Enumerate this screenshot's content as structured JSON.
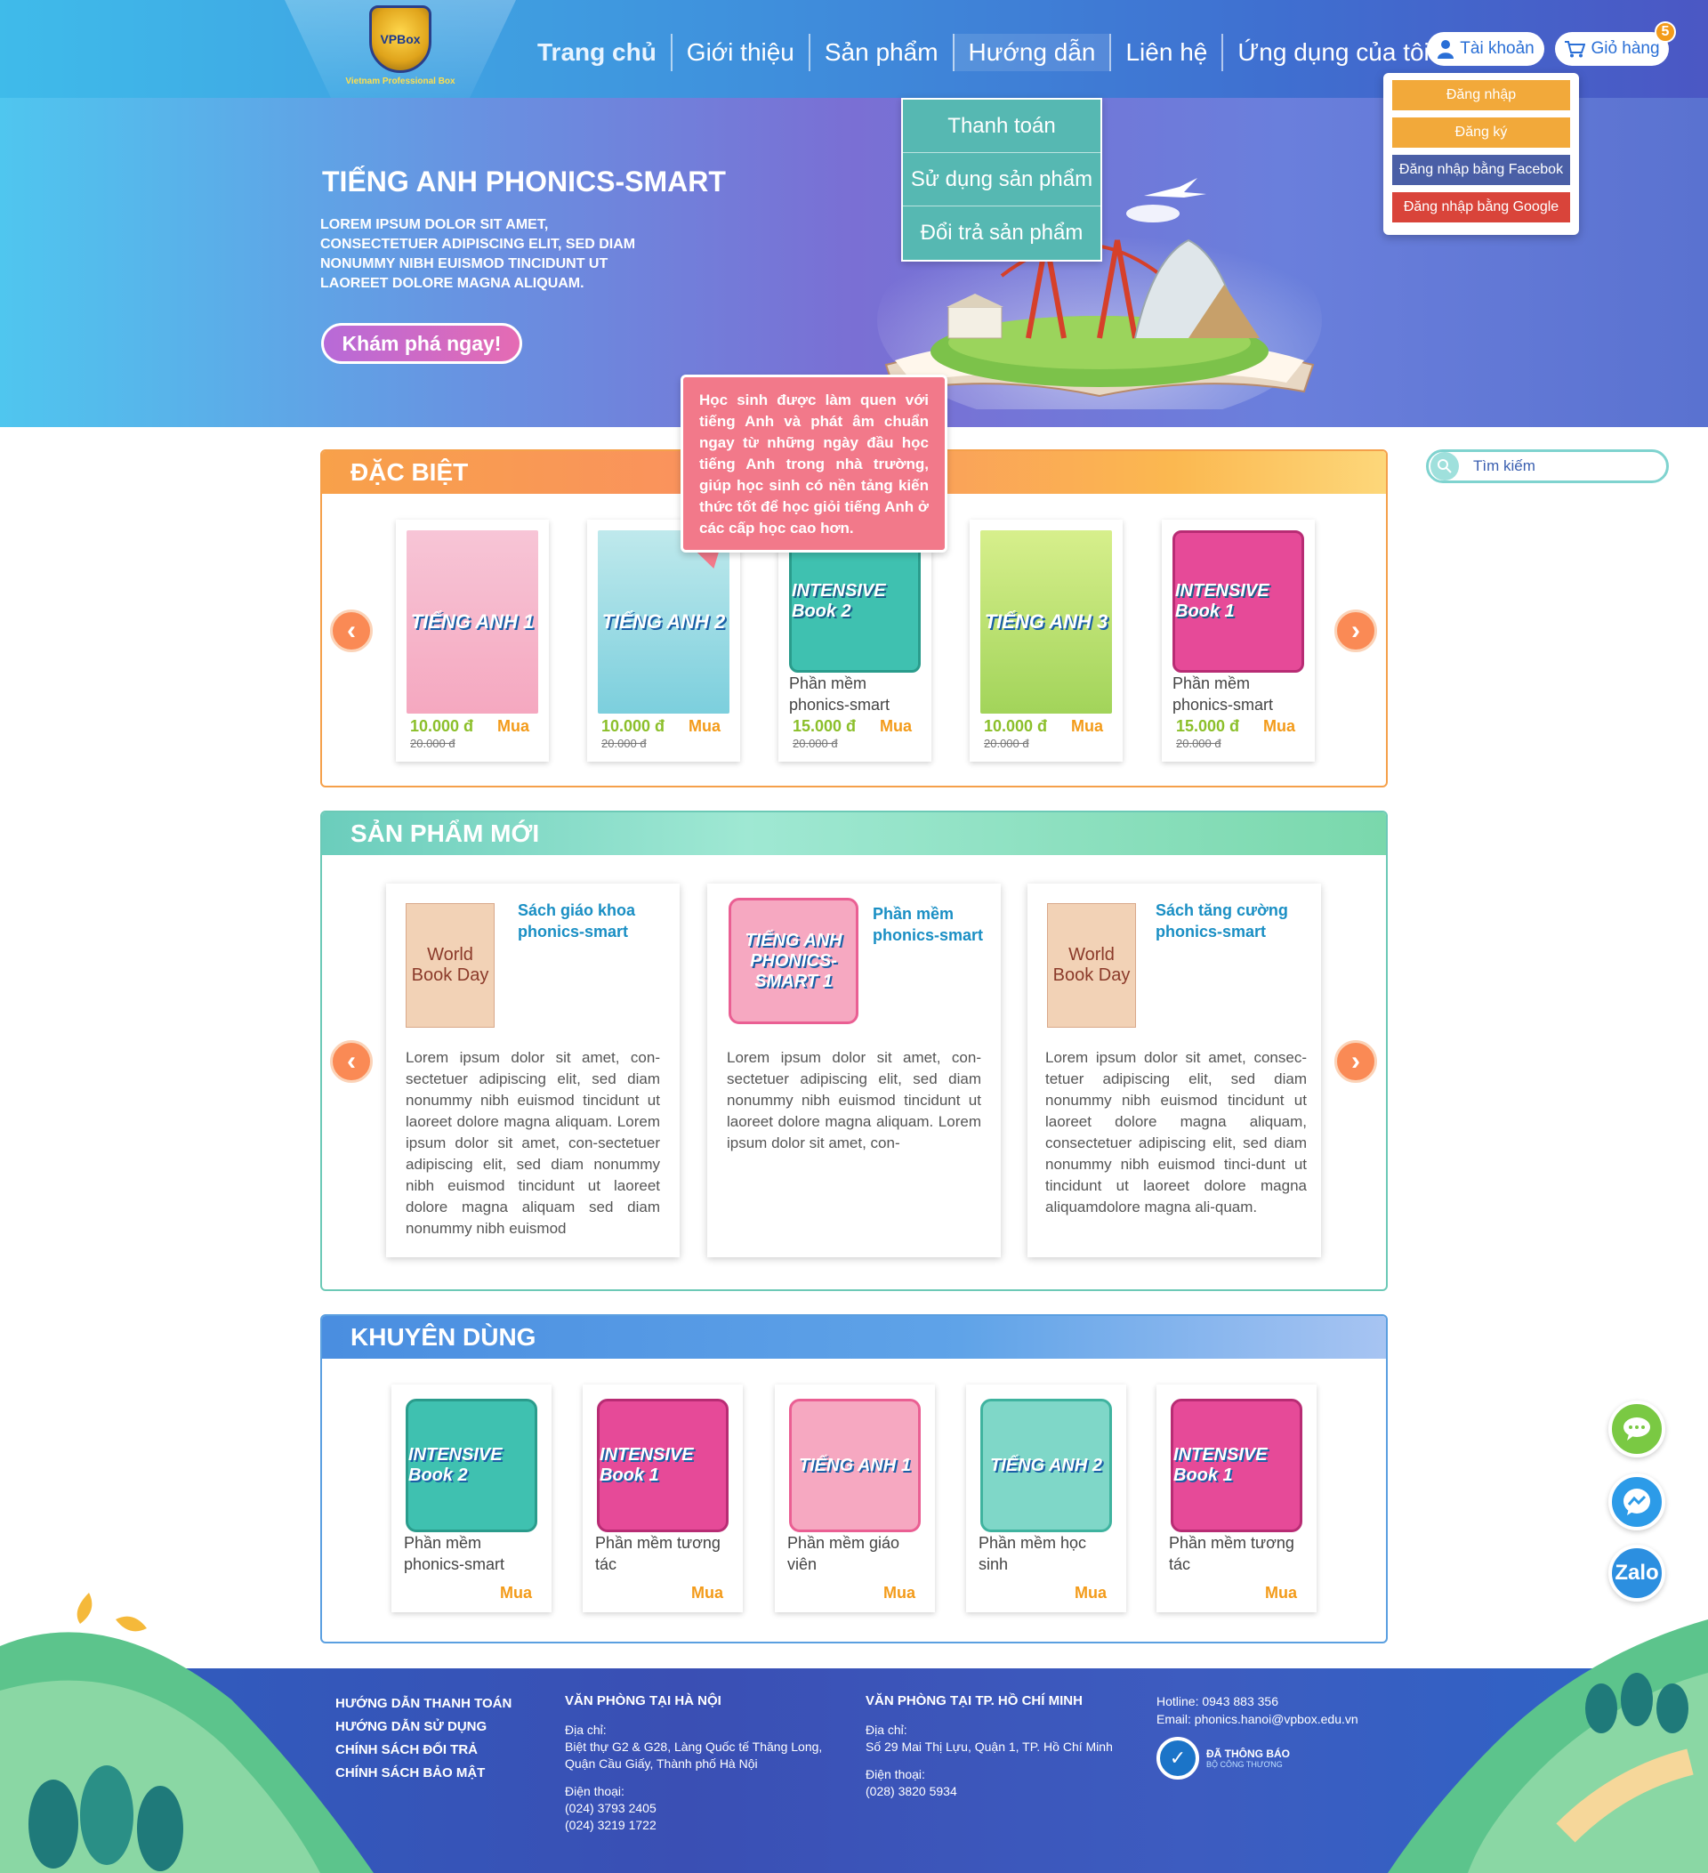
{
  "logo": {
    "text": "Vietnam Professional Box",
    "badge": "VPBox"
  },
  "nav": [
    {
      "label": "Trang chủ"
    },
    {
      "label": "Giới thiệu"
    },
    {
      "label": "Sản phẩm"
    },
    {
      "label": "Hướng dẫn"
    },
    {
      "label": "Liên hệ"
    },
    {
      "label": "Ứng dụng của tôi"
    }
  ],
  "account": {
    "label": "Tài khoản",
    "icon": "user-icon"
  },
  "cart": {
    "label": "Giỏ hàng",
    "icon": "cart-icon",
    "count": "5"
  },
  "guide_menu": [
    "Thanh toán",
    "Sử dụng sản phẩm",
    "Đổi trả sản phẩm"
  ],
  "account_menu": {
    "login": "Đăng nhập",
    "register": "Đăng ký",
    "facebook": "Đăng nhập bằng Facebok",
    "google": "Đăng nhập bằng Google"
  },
  "hero": {
    "title": "TIẾNG ANH PHONICS-SMART",
    "description": "LOREM IPSUM DOLOR SIT AMET, CONSECTETUER ADIPISCING ELIT, SED DIAM NONUMMY NIBH EUISMOD TINCIDUNT UT LAOREET DOLORE MAGNA ALIQUAM.",
    "cta": "Khám phá ngay!"
  },
  "tooltip": "Học sinh được làm quen với tiếng Anh và phát âm chuẩn ngay từ những ngày đầu học tiếng Anh trong nhà trường, giúp học sinh có nền tảng kiến thức tốt để học giỏi tiếng Anh ở các cấp học cao hơn.",
  "search": {
    "placeholder": "Tìm kiếm"
  },
  "special": {
    "title": "ĐẶC BIỆT",
    "items": [
      {
        "cover": "TIẾNG ANH 1",
        "name": "",
        "price": "10.000 đ",
        "old_price": "20.000 đ",
        "buy": "Mua"
      },
      {
        "cover": "TIẾNG ANH 2",
        "name": "",
        "price": "10.000 đ",
        "old_price": "20.000 đ",
        "buy": "Mua"
      },
      {
        "cover": "INTENSIVE Book 2",
        "name": "Phần mềm phonics-smart",
        "price": "15.000 đ",
        "old_price": "20.000 đ",
        "buy": "Mua"
      },
      {
        "cover": "TIẾNG ANH 3",
        "name": "",
        "price": "10.000 đ",
        "old_price": "20.000 đ",
        "buy": "Mua"
      },
      {
        "cover": "INTENSIVE Book 1",
        "name": "Phần mềm phonics-smart",
        "price": "15.000 đ",
        "old_price": "20.000 đ",
        "buy": "Mua"
      }
    ]
  },
  "new_products": {
    "title": "SẢN PHẨM MỚI",
    "items": [
      {
        "title": "Sách giáo khoa phonics-smart",
        "thumb": "World Book Day",
        "desc": "Lorem ipsum dolor sit amet, con-sectetuer adipiscing elit, sed diam nonummy nibh euismod tincidunt ut laoreet dolore magna aliquam. Lorem ipsum dolor sit amet, con-sectetuer adipiscing elit, sed diam nonummy nibh euismod tincidunt ut laoreet dolore magna aliquam sed diam nonummy nibh euismod"
      },
      {
        "title": "Phần mềm phonics-smart",
        "thumb": "TIẾNG ANH PHONICS-SMART 1",
        "desc": "Lorem ipsum dolor sit amet, con-sectetuer adipiscing elit, sed diam nonummy nibh euismod tincidunt ut laoreet dolore magna aliquam. Lorem ipsum dolor sit amet, con-"
      },
      {
        "title": "Sách tăng cường phonics-smart",
        "thumb": "World Book Day",
        "desc": "Lorem ipsum dolor sit amet, consec-tetuer adipiscing elit, sed diam nonummy nibh euismod tincidunt ut laoreet dolore magna aliquam, consectetuer adipiscing elit, sed diam nonummy nibh euismod tinci-dunt ut tincidunt ut laoreet dolore magna aliquamdolore magna ali-quam."
      }
    ]
  },
  "recommended": {
    "title": "KHUYÊN DÙNG",
    "items": [
      {
        "cover": "INTENSIVE Book 2",
        "name": "Phần mềm phonics-smart",
        "buy": "Mua"
      },
      {
        "cover": "INTENSIVE Book 1",
        "name": "Phần mềm tương tác",
        "buy": "Mua"
      },
      {
        "cover": "TIẾNG ANH 1",
        "name": "Phần mềm giáo viên",
        "buy": "Mua"
      },
      {
        "cover": "TIẾNG ANH 2",
        "name": "Phần mềm học sinh",
        "buy": "Mua"
      },
      {
        "cover": "INTENSIVE Book 1",
        "name": "Phần mềm tương tác",
        "buy": "Mua"
      }
    ]
  },
  "floating": {
    "zalo": "Zalo"
  },
  "footer": {
    "links": [
      "HƯỚNG DẪN THANH TOÁN",
      "HƯỚNG DẪN SỬ DỤNG",
      "CHÍNH SÁCH ĐỔI TRẢ",
      "CHÍNH SÁCH BẢO MẬT"
    ],
    "hanoi": {
      "heading": "VĂN PHÒNG TẠI HÀ NỘI",
      "addr_label": "Địa chỉ:",
      "addr1": "Biệt thự G2 & G28, Làng Quốc tế Thăng Long,",
      "addr2": "Quận Cầu Giấy, Thành phố Hà Nội",
      "phone_label": "Điện thoại:",
      "phone1": "(024) 3793 2405",
      "phone2": "(024) 3219 1722"
    },
    "hcm": {
      "heading": "VĂN PHÒNG TẠI TP. HỒ CHÍ MINH",
      "addr_label": "Địa chỉ:",
      "addr1": "Số 29 Mai Thị Lựu, Quận 1, TP. Hồ Chí Minh",
      "phone_label": "Điện thoại:",
      "phone1": "(028) 3820 5934"
    },
    "hotline": "Hotline: 0943 883 356",
    "email": "Email: phonics.hanoi@vpbox.edu.vn",
    "bct": "ĐÃ THÔNG BÁO",
    "bct_sub": "BỘ CÔNG THƯƠNG"
  }
}
